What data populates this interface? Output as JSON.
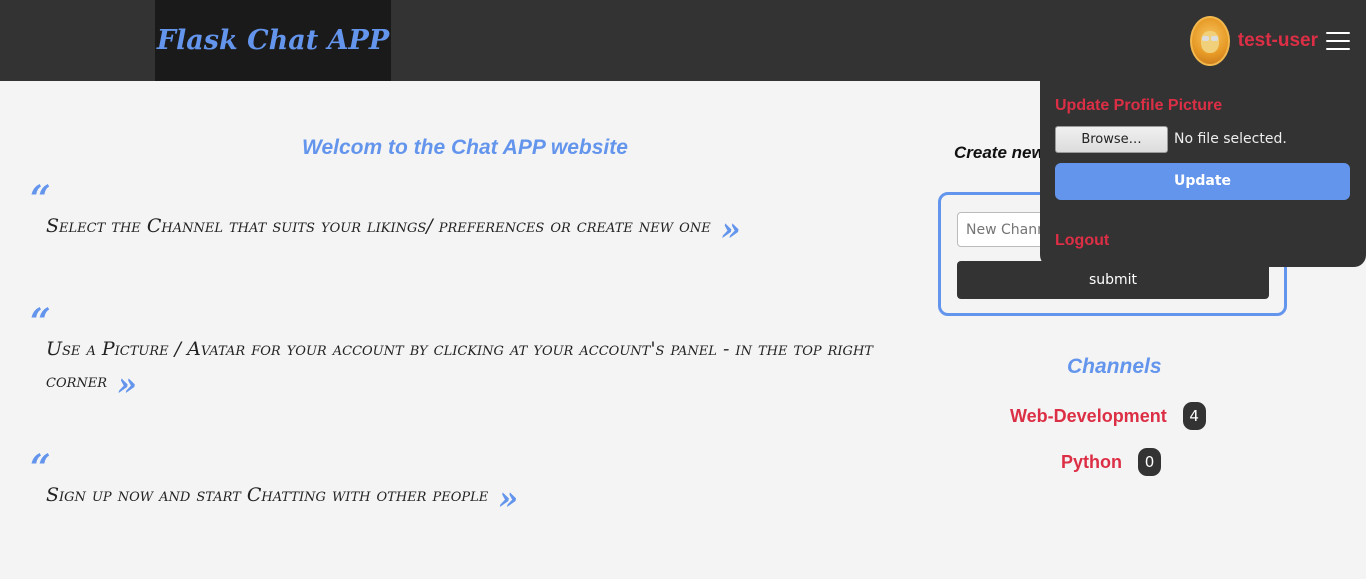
{
  "brand": {
    "title": "Flask Chat APP"
  },
  "account": {
    "username": "test-user"
  },
  "dropdown": {
    "title": "Update Profile Picture",
    "browse_label": "Browse…",
    "file_status": "No file selected.",
    "update_label": "Update",
    "logout_label": "Logout"
  },
  "main": {
    "welcome": "Welcom to the Chat APP website",
    "open_quote": "“",
    "close_quote": "»",
    "quotes": [
      "Select the Channel that suits your likings/ preferences or create new one",
      "Use a Picture / Avatar for your account by clicking at your account's panel - in the top right corner",
      "Sign up now and start Chatting with other people"
    ]
  },
  "create": {
    "title": "Create new Channel",
    "input_placeholder": "New Channel",
    "submit_label": "submit"
  },
  "channels": {
    "title": "Channels",
    "items": [
      {
        "name": "Web-Development",
        "count": "4"
      },
      {
        "name": "Python",
        "count": "0"
      }
    ]
  }
}
